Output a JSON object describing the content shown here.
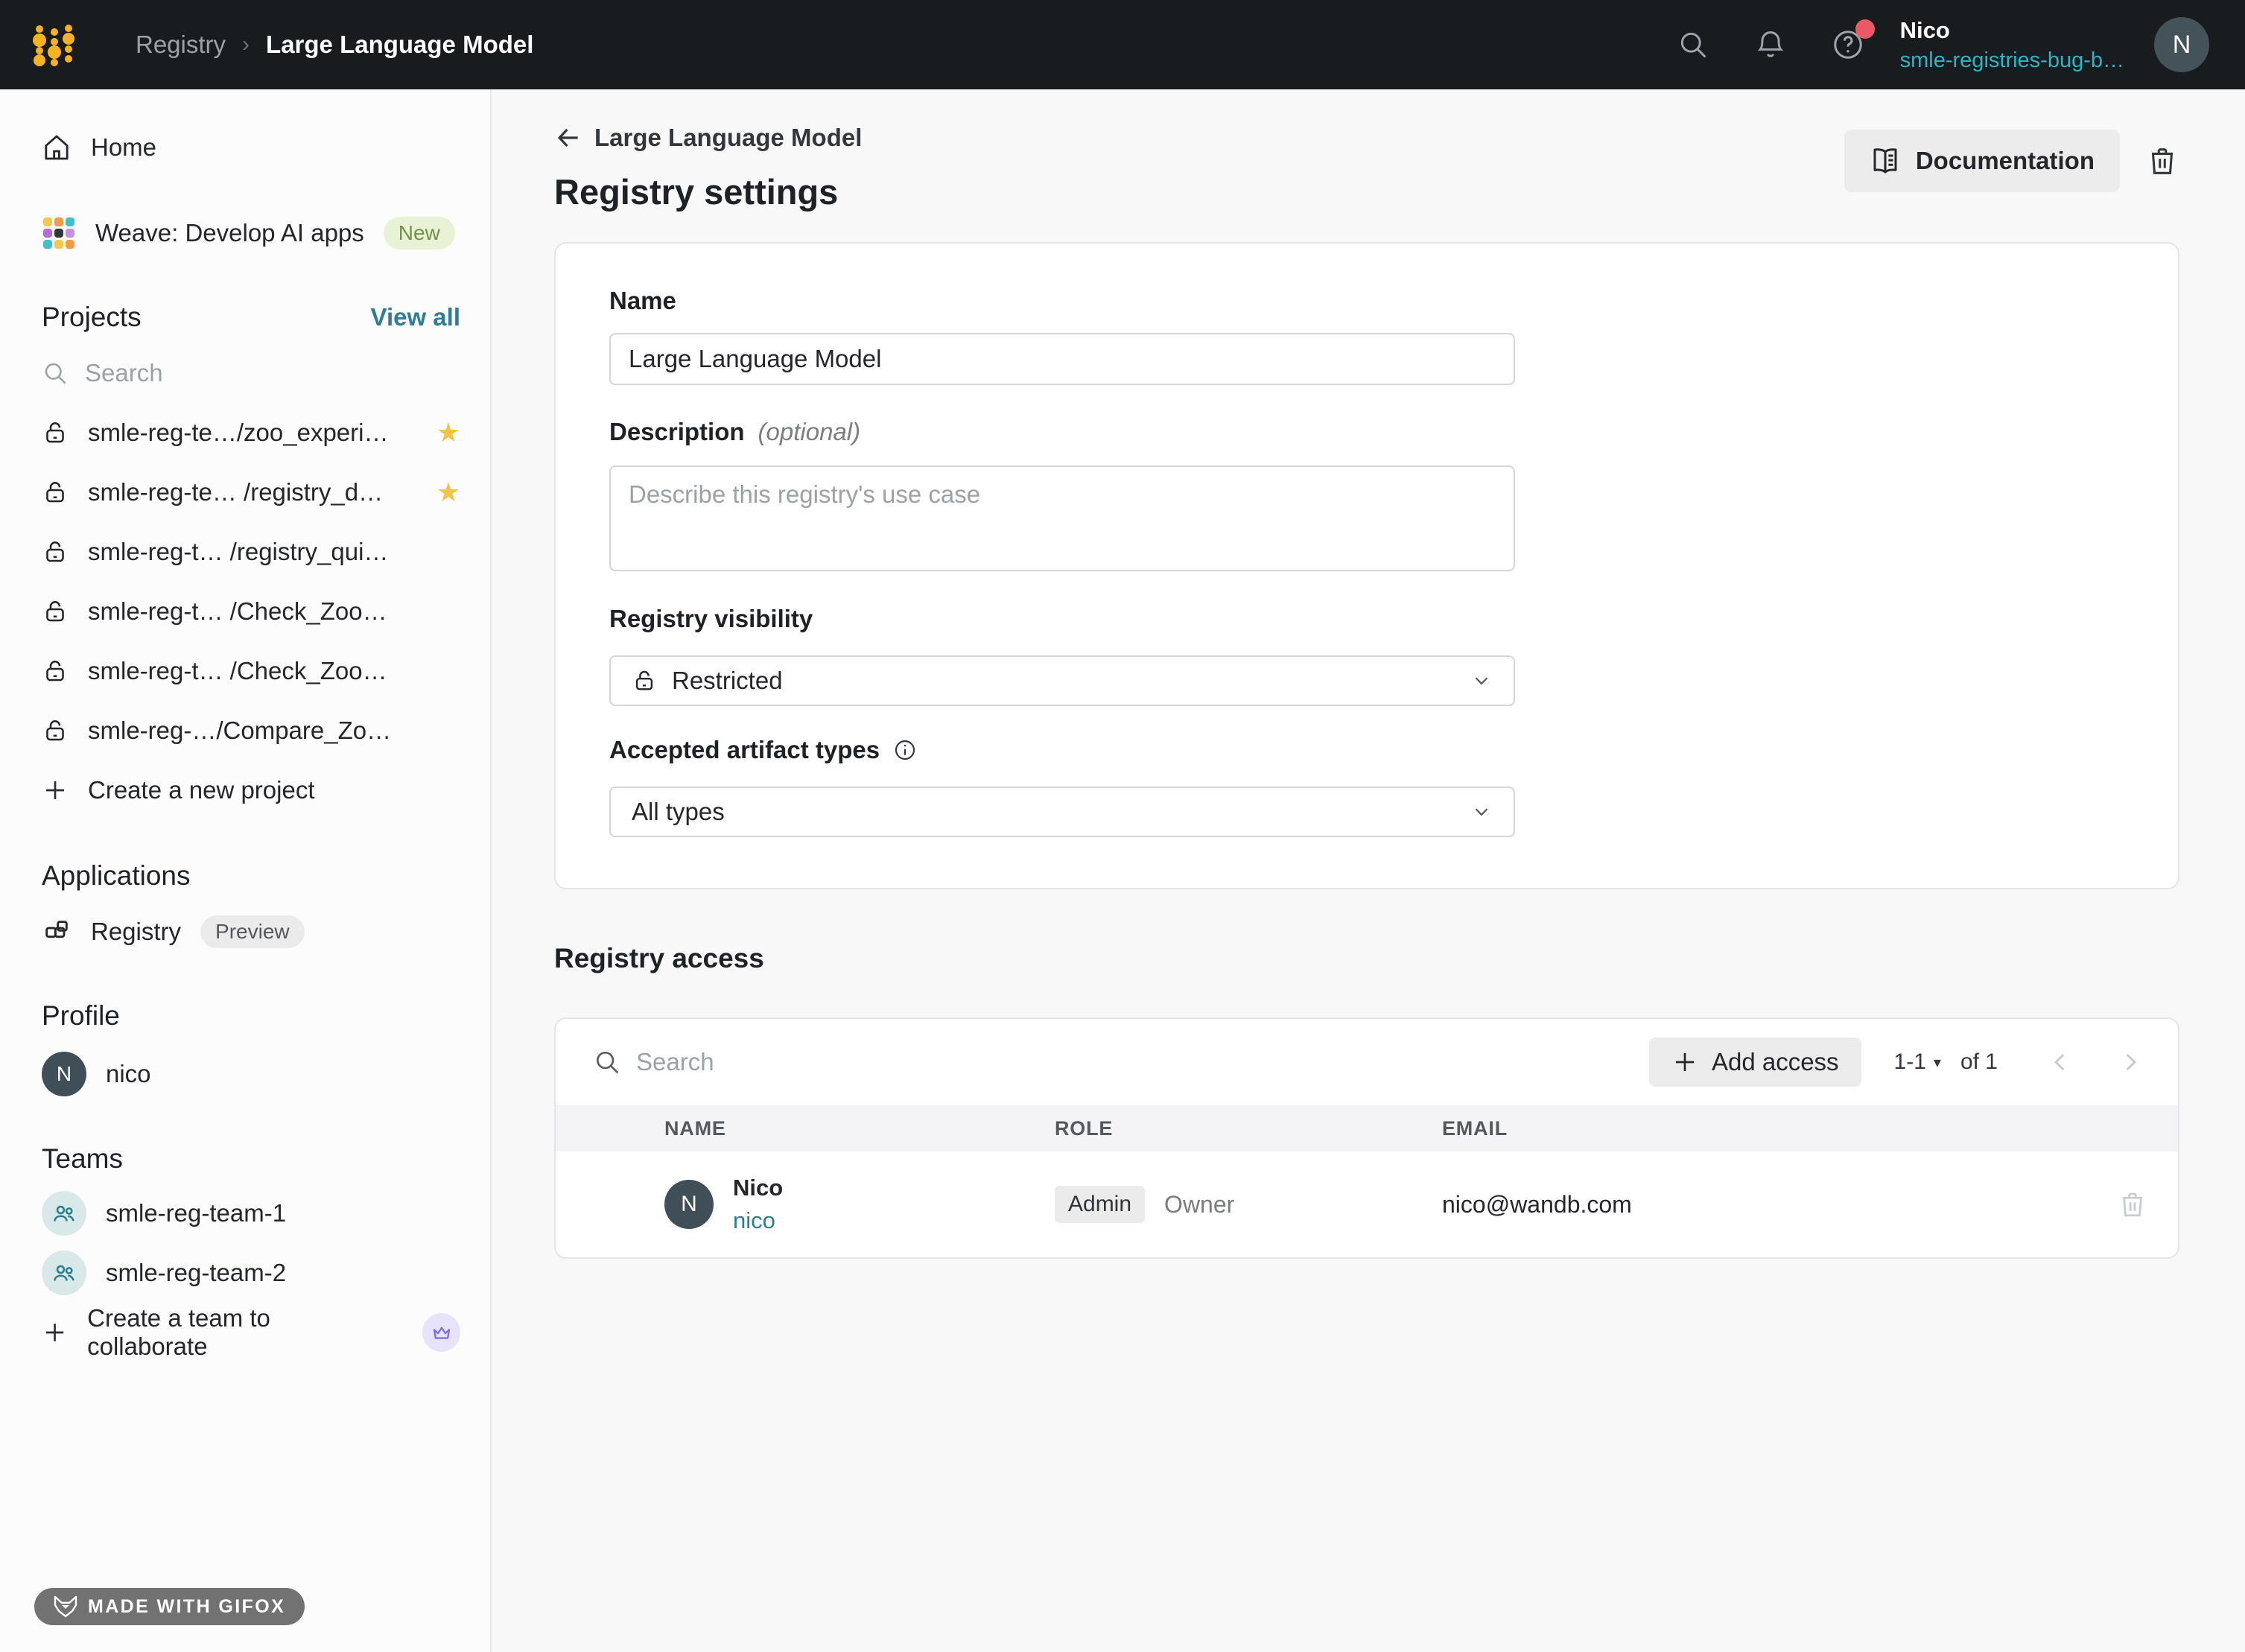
{
  "navbar": {
    "breadcrumb": {
      "section": "Registry",
      "page": "Large Language Model"
    },
    "user": {
      "name": "Nico",
      "team": "smle-registries-bug-b…",
      "avatar_initial": "N"
    }
  },
  "sidebar": {
    "home_label": "Home",
    "weave": {
      "label": "Weave: Develop AI apps",
      "badge": "New"
    },
    "projects": {
      "title": "Projects",
      "view_all": "View all",
      "search_placeholder": "Search",
      "items": [
        {
          "label": "smle-reg-te…/zoo_experi…",
          "starred": true
        },
        {
          "label": "smle-reg-te… /registry_d…",
          "starred": true
        },
        {
          "label": "smle-reg-t… /registry_qui…",
          "starred": false
        },
        {
          "label": "smle-reg-t… /Check_Zoo…",
          "starred": false
        },
        {
          "label": "smle-reg-t… /Check_Zoo…",
          "starred": false
        },
        {
          "label": "smle-reg-…/Compare_Zo…",
          "starred": false
        }
      ],
      "create_label": "Create a new project"
    },
    "applications": {
      "title": "Applications",
      "registry_label": "Registry",
      "registry_badge": "Preview"
    },
    "profile": {
      "title": "Profile",
      "user": "nico",
      "avatar_initial": "N"
    },
    "teams": {
      "title": "Teams",
      "items": [
        "smle-reg-team-1",
        "smle-reg-team-2"
      ],
      "create_label": "Create a team to collaborate"
    },
    "footer_badge": "MADE WITH GIFOX"
  },
  "main": {
    "back_label": "Large Language Model",
    "title": "Registry settings",
    "documentation_label": "Documentation",
    "form": {
      "name_label": "Name",
      "name_value": "Large Language Model",
      "description_label": "Description",
      "description_optional": "(optional)",
      "description_placeholder": "Describe this registry's use case",
      "visibility_label": "Registry visibility",
      "visibility_value": "Restricted",
      "artifact_types_label": "Accepted artifact types",
      "artifact_types_value": "All types"
    },
    "access": {
      "title": "Registry access",
      "search_placeholder": "Search",
      "add_access_label": "Add access",
      "pagination": {
        "range": "1-1",
        "of": "of 1"
      },
      "table": {
        "headers": [
          "NAME",
          "ROLE",
          "EMAIL"
        ],
        "rows": [
          {
            "name": "Nico",
            "username": "nico",
            "avatar_initial": "N",
            "role_badge": "Admin",
            "role": "Owner",
            "email": "nico@wandb.com"
          }
        ]
      }
    }
  },
  "colors": {
    "navbar_bg": "#191C1F",
    "link_teal": "#2D7D96",
    "nav_team_cyan": "#2FB3C6",
    "brand_yellow": "#F6B321",
    "star_yellow": "#F5C34B",
    "alert_red": "#E85A65",
    "badge_new_bg": "#E9F2D4",
    "badge_gray_bg": "#EBEBEC",
    "card_border": "#E4E5E7",
    "page_bg": "#F8F8F9"
  }
}
